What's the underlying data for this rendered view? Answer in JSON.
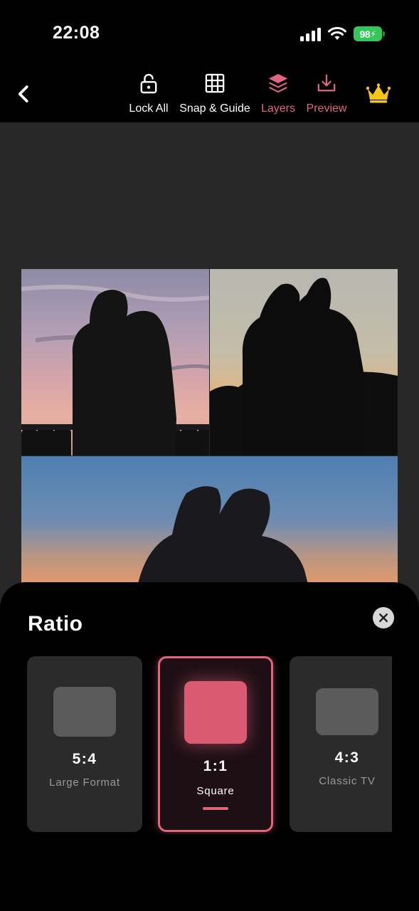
{
  "status": {
    "time": "22:08",
    "battery": "98",
    "icons": [
      "signal-icon",
      "wifi-icon",
      "battery-charging-icon"
    ]
  },
  "toolbar": {
    "back_icon": "chevron-left-icon",
    "tools": [
      {
        "label": "Lock All",
        "icon": "lock-open-icon"
      },
      {
        "label": "Snap & Guide",
        "icon": "grid-icon"
      },
      {
        "label": "Layers",
        "icon": "layers-icon",
        "active": true
      },
      {
        "label": "Preview",
        "icon": "download-icon"
      }
    ],
    "premium_icon": "crown-icon"
  },
  "collage": {
    "photos": [
      "silhouette-couple-sunset-1",
      "silhouette-couple-sunset-2",
      "silhouette-couple-sunset-3"
    ]
  },
  "ratio_sheet": {
    "title": "Ratio",
    "close_icon": "close-icon",
    "options": [
      {
        "ratio": "5:4",
        "name": "Large Format",
        "selected": false
      },
      {
        "ratio": "1:1",
        "name": "Square",
        "selected": true
      },
      {
        "ratio": "4:3",
        "name": "Classic TV",
        "selected": false
      }
    ]
  },
  "colors": {
    "accent": "#e0667e",
    "background": "#000000",
    "canvas": "#282828",
    "battery": "#34c759",
    "crown": "#f5c518"
  }
}
